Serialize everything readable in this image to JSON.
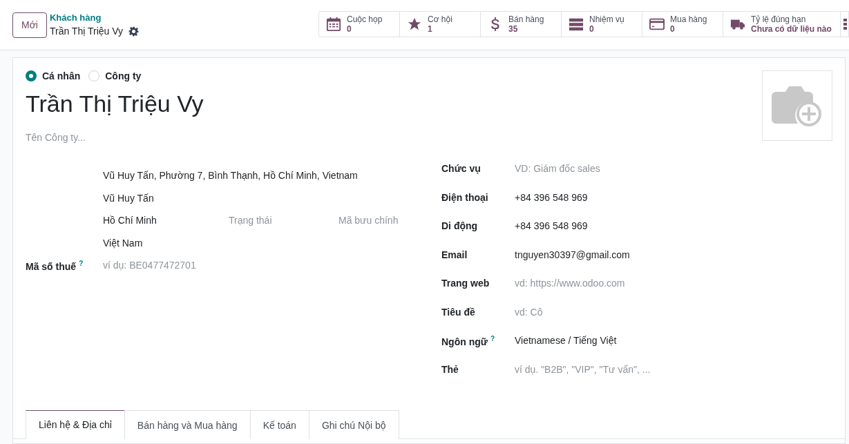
{
  "control_panel": {
    "new_button": "Mới",
    "breadcrumb": "Khách hàng",
    "record_title": "Trần Thị Triệu Vy"
  },
  "smart_buttons": [
    {
      "label": "Cuộc họp",
      "value": "0"
    },
    {
      "label": "Cơ hội",
      "value": "1"
    },
    {
      "label": "Bán hàng",
      "value": "35"
    },
    {
      "label": "Nhiệm vụ",
      "value": "0"
    },
    {
      "label": "Mua hàng",
      "value": "0"
    },
    {
      "label": "Tỷ lệ đúng hạn",
      "value": "Chưa có dữ liệu nào"
    }
  ],
  "partner_type": [
    {
      "label": "Cá nhân",
      "selected": true
    },
    {
      "label": "Công ty",
      "selected": false
    }
  ],
  "name": "Trần Thị Triệu Vy",
  "company_name": {
    "placeholder": "Tên Công ty..."
  },
  "address": {
    "summary": "Vũ Huy Tấn, Phường 7, Bình Thạnh, Hồ Chí Minh, Vietnam",
    "street": "Vũ Huy Tấn",
    "city": "Hồ Chí Minh",
    "state": {
      "placeholder": "Trạng thái"
    },
    "zip": {
      "placeholder": "Mã bưu chính"
    },
    "country": "Việt Nam"
  },
  "left_fields": [
    {
      "label": "Mã số thuế",
      "help": "?",
      "placeholder": "ví dụ: BE0477472701"
    }
  ],
  "right_fields": [
    {
      "label": "Chức vụ",
      "placeholder": "VD: Giám đốc sales"
    },
    {
      "label": "Điện thoại",
      "value": "+84 396 548 969"
    },
    {
      "label": "Di động",
      "value": "+84 396 548 969"
    },
    {
      "label": "Email",
      "value": "tnguyen30397@gmail.com"
    },
    {
      "label": "Trang web",
      "placeholder": "vd: https://www.odoo.com"
    },
    {
      "label": "Tiêu đề",
      "placeholder": "vd: Cô"
    },
    {
      "label": "Ngôn ngữ",
      "help": "?",
      "value": "Vietnamese / Tiếng Việt"
    },
    {
      "label": "Thẻ",
      "placeholder": "ví dụ. \"B2B\", \"VIP\", \"Tư vấn\", ..."
    }
  ],
  "tabs": [
    {
      "label": "Liên hệ & Địa chỉ",
      "selected": true
    },
    {
      "label": "Bán hàng và Mua hàng",
      "selected": false
    },
    {
      "label": "Kế toán",
      "selected": false
    },
    {
      "label": "Ghi chú Nội bộ",
      "selected": false
    }
  ]
}
